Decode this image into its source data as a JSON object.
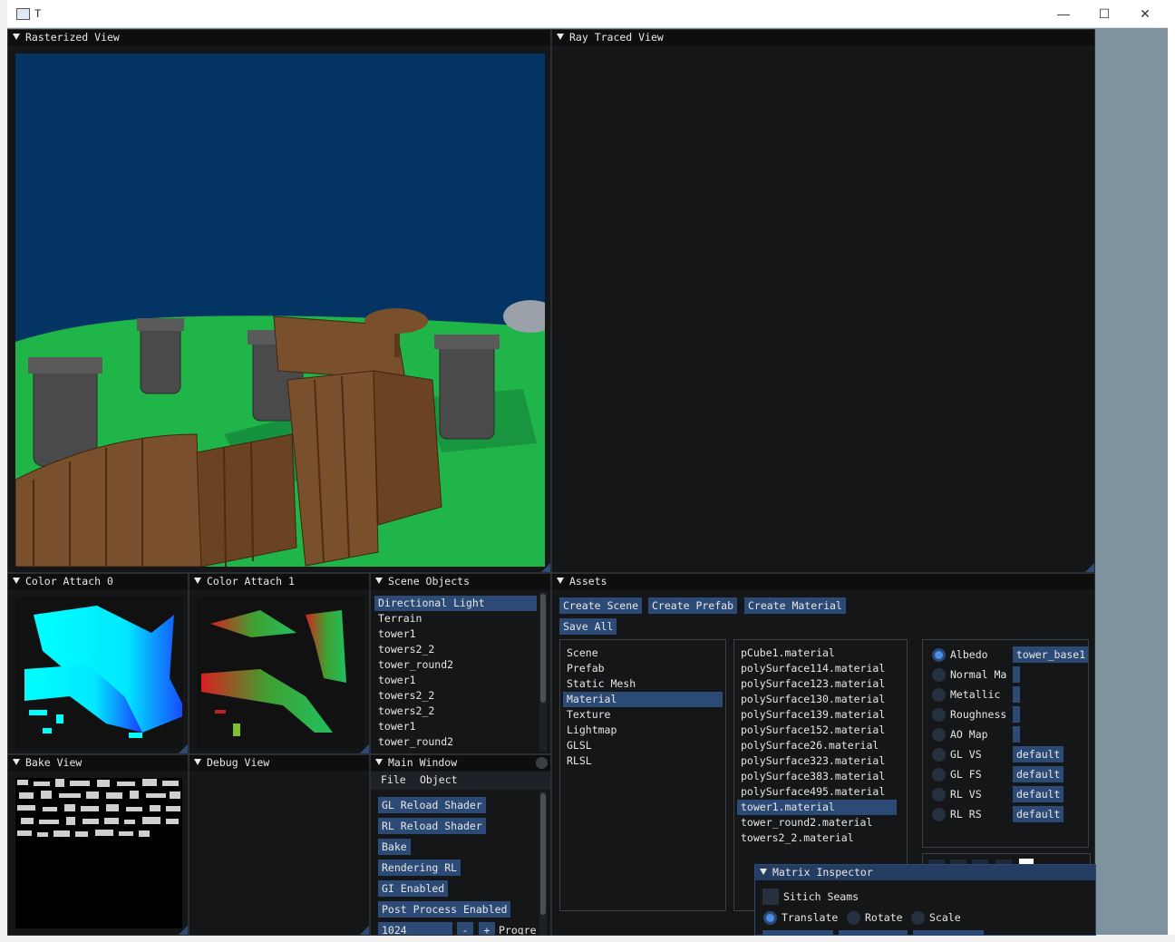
{
  "window": {
    "title": "T",
    "minimize": "—",
    "maximize": "☐",
    "close": "✕"
  },
  "panels": {
    "rasterized": "Rasterized View",
    "ray_traced": "Ray Traced View",
    "color_attach_0": "Color Attach 0",
    "color_attach_1": "Color Attach 1",
    "scene_objects": "Scene Objects",
    "assets": "Assets",
    "bake_view": "Bake View",
    "debug_view": "Debug View",
    "main_window": "Main Window",
    "matrix_inspector": "Matrix Inspector"
  },
  "scene_objects": {
    "selected": "Directional Light",
    "items": [
      "Directional Light",
      "Terrain",
      "tower1",
      "towers2_2",
      "tower_round2",
      "tower1",
      "towers2_2",
      "towers2_2",
      "tower1",
      "tower_round2"
    ]
  },
  "assets": {
    "buttons": [
      "Create Scene",
      "Create Prefab",
      "Create Material",
      "Save All"
    ],
    "categories": [
      "Scene",
      "Prefab",
      "Static Mesh",
      "Material",
      "Texture",
      "Lightmap",
      "GLSL",
      "RLSL"
    ],
    "selected_category": "Material",
    "materials": [
      "pCube1.material",
      "polySurface114.material",
      "polySurface123.material",
      "polySurface130.material",
      "polySurface139.material",
      "polySurface152.material",
      "polySurface26.material",
      "polySurface323.material",
      "polySurface383.material",
      "polySurface495.material",
      "tower1.material",
      "tower_round2.material",
      "towers2_2.material"
    ],
    "selected_material": "tower1.material",
    "properties": [
      {
        "label": "Albedo",
        "value": "tower_base1",
        "selected": true
      },
      {
        "label": "Normal Ma",
        "value": ""
      },
      {
        "label": "Metallic",
        "value": ""
      },
      {
        "label": "Roughness",
        "value": ""
      },
      {
        "label": "AO Map",
        "value": ""
      },
      {
        "label": "GL VS",
        "value": "default"
      },
      {
        "label": "GL FS",
        "value": "default"
      },
      {
        "label": "RL VS",
        "value": "default"
      },
      {
        "label": "RL RS",
        "value": "default"
      }
    ]
  },
  "main_window": {
    "menu": [
      "File",
      "Object"
    ],
    "buttons": [
      "GL Reload Shader",
      "RL Reload Shader",
      "Bake",
      "Rendering RL",
      "GI Enabled",
      "Post Process Enabled"
    ],
    "resolution": "1024",
    "minus": "-",
    "plus": "+",
    "progress_label": "Progre"
  },
  "matrix_inspector": {
    "checkbox_label": "Sitich Seams",
    "modes": [
      "Translate",
      "Rotate",
      "Scale"
    ],
    "selected_mode": "Translate"
  },
  "colors": {
    "accent": "#2c4a76",
    "title_active": "#253d62",
    "sky": "#033463",
    "terrain": "#1fb548"
  }
}
